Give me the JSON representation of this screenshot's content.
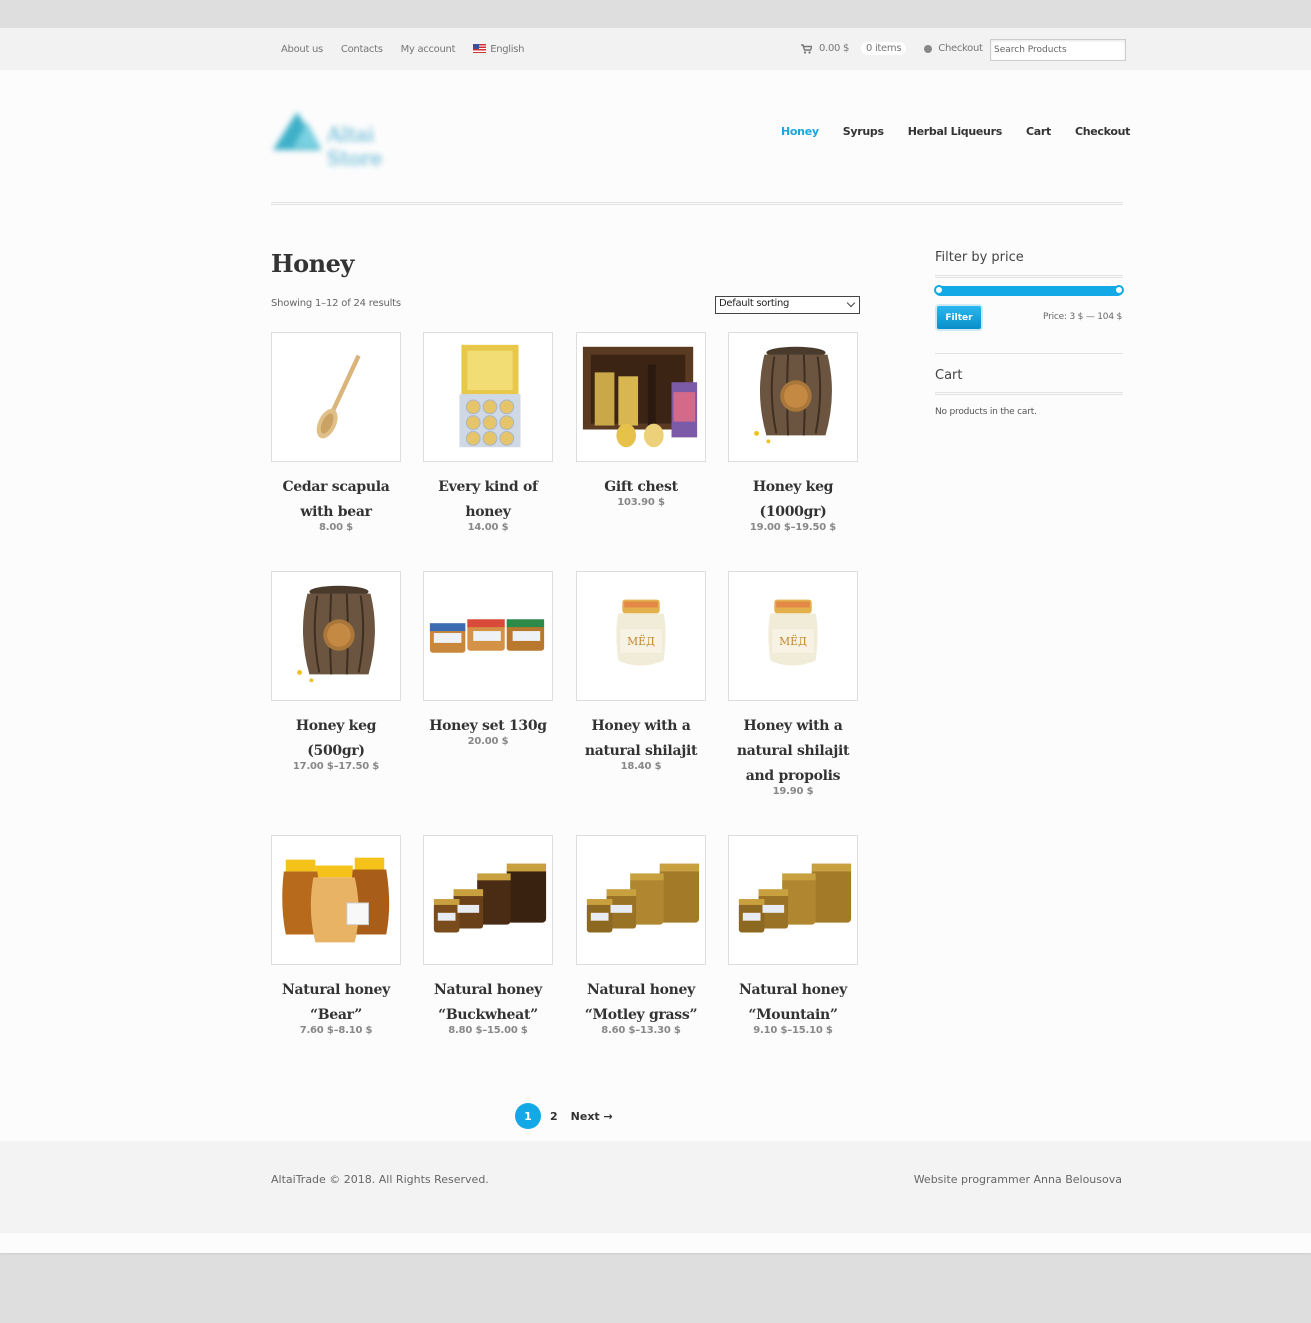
{
  "topbar": {
    "links": [
      "About us",
      "Contacts",
      "My account"
    ],
    "language": "English",
    "cart_total": "0.00 $",
    "cart_items": "0 items",
    "checkout": "Checkout",
    "search_placeholder": "Search Products"
  },
  "header": {
    "logo_text": "Altai Store",
    "nav": [
      "Honey",
      "Syrups",
      "Herbal Liqueurs",
      "Cart",
      "Checkout"
    ],
    "active_nav": "Honey"
  },
  "main": {
    "title": "Honey",
    "result_count": "Showing 1–12 of 24 results",
    "sort_selected": "Default sorting",
    "products": [
      {
        "name": "Cedar scapula with bear",
        "price": "8.00 $",
        "image": "wooden-spoon"
      },
      {
        "name": "Every kind of honey",
        "price": "14.00 $",
        "image": "honey-gift-box"
      },
      {
        "name": "Gift chest",
        "price": "103.90 $",
        "image": "gift-chest"
      },
      {
        "name": "Honey keg (1000gr)",
        "price": "19.00 $–19.50 $",
        "image": "wooden-keg"
      },
      {
        "name": "Honey keg (500gr)",
        "price": "17.00 $–17.50 $",
        "image": "wooden-keg"
      },
      {
        "name": "Honey set 130g",
        "price": "20.00 $",
        "image": "honey-jar-set"
      },
      {
        "name": "Honey with a natural shilajit",
        "price": "18.40 $",
        "image": "honey-jar"
      },
      {
        "name": "Honey with a natural shilajit and propolis",
        "price": "19.90 $",
        "image": "honey-jar"
      },
      {
        "name": "Natural honey “Bear”",
        "price": "7.60 $–8.10 $",
        "image": "bear-jars"
      },
      {
        "name": "Natural honey “Buckwheat”",
        "price": "8.80 $–15.00 $",
        "image": "dark-jars"
      },
      {
        "name": "Natural honey “Motley grass”",
        "price": "8.60 $–13.30 $",
        "image": "amber-jars"
      },
      {
        "name": "Natural honey “Mountain”",
        "price": "9.10 $–15.10 $",
        "image": "amber-jars"
      }
    ]
  },
  "pagination": {
    "current": "1",
    "next_page": "2",
    "next_label": "Next →"
  },
  "sidebar": {
    "filter_title": "Filter by price",
    "filter_button": "Filter",
    "price_range": "Price: 3 $ — 104 $",
    "price_min": 3,
    "price_max": 104,
    "cart_title": "Cart",
    "cart_empty": "No products in the cart."
  },
  "footer": {
    "copyright": "AltaiTrade © 2018. All Rights Reserved.",
    "credit": "Website programmer Anna Belousova"
  },
  "colors": {
    "accent": "#12a9e6",
    "text": "#333333",
    "muted": "#888888"
  }
}
